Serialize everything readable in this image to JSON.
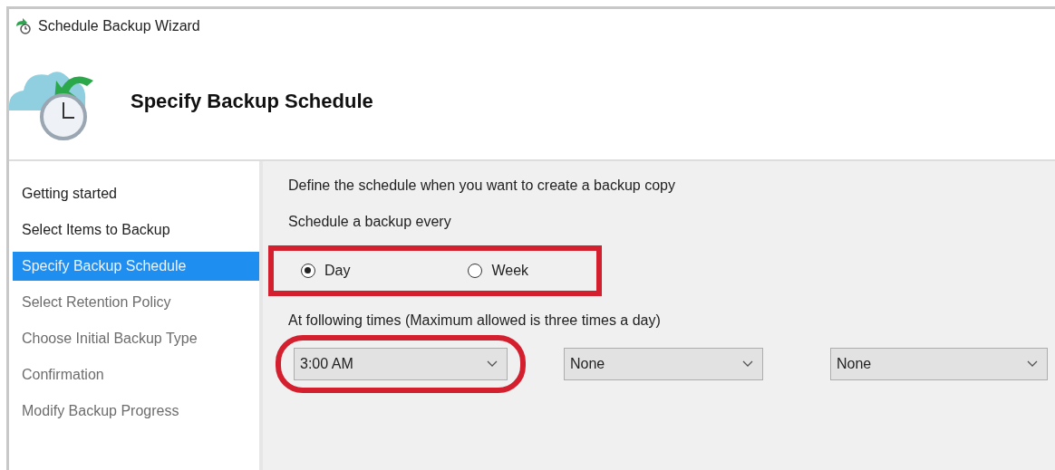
{
  "window": {
    "title": "Schedule Backup Wizard"
  },
  "header": {
    "title": "Specify Backup Schedule"
  },
  "sidebar": {
    "items": [
      {
        "label": "Getting started",
        "selected": false,
        "disabled": false
      },
      {
        "label": "Select Items to Backup",
        "selected": false,
        "disabled": false
      },
      {
        "label": "Specify Backup Schedule",
        "selected": true,
        "disabled": false
      },
      {
        "label": "Select Retention Policy",
        "selected": false,
        "disabled": true
      },
      {
        "label": "Choose Initial Backup Type",
        "selected": false,
        "disabled": true
      },
      {
        "label": "Confirmation",
        "selected": false,
        "disabled": true
      },
      {
        "label": "Modify Backup Progress",
        "selected": false,
        "disabled": true
      }
    ]
  },
  "content": {
    "description": "Define the schedule when you want to create a backup copy",
    "frequency_label": "Schedule a backup every",
    "frequency": {
      "highlighted": true,
      "options": [
        {
          "label": "Day",
          "selected": true
        },
        {
          "label": "Week",
          "selected": false
        }
      ]
    },
    "times_label": "At following times (Maximum allowed is three times a day)",
    "times": [
      {
        "value": "3:00 AM",
        "highlighted": true
      },
      {
        "value": "None",
        "highlighted": false
      },
      {
        "value": "None",
        "highlighted": false
      }
    ]
  }
}
